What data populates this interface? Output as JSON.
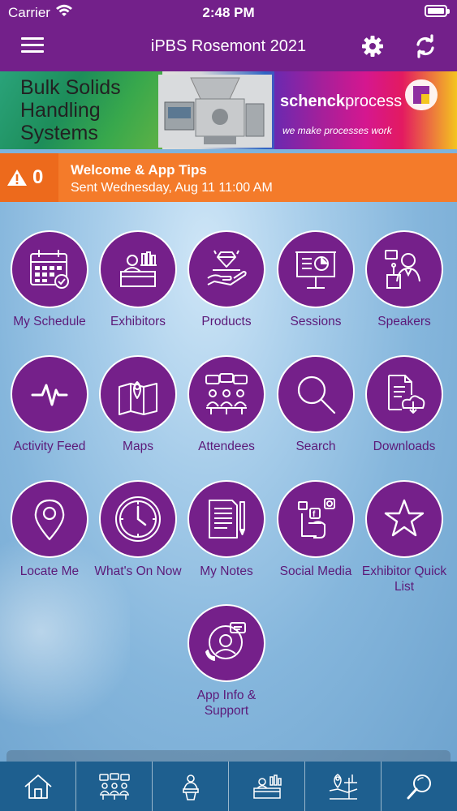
{
  "status_bar": {
    "carrier": "Carrier",
    "time": "2:48 PM"
  },
  "header": {
    "title": "iPBS Rosemont 2021"
  },
  "banner": {
    "headline": [
      "Bulk Solids",
      "Handling",
      "Systems"
    ],
    "brand_prefix": "schenck",
    "brand_suffix": "process",
    "slogan": "we make processes work"
  },
  "alert": {
    "count": "0",
    "title": "Welcome & App Tips",
    "subtitle": "Sent Wednesday, Aug 11 11:00 AM"
  },
  "tiles": [
    {
      "label": "My Schedule",
      "icon": "calendar-icon"
    },
    {
      "label": "Exhibitors",
      "icon": "exhibitor-booth-icon"
    },
    {
      "label": "Products",
      "icon": "product-hand-icon"
    },
    {
      "label": "Sessions",
      "icon": "presentation-board-icon"
    },
    {
      "label": "Speakers",
      "icon": "speaker-podium-icon"
    },
    {
      "label": "Activity Feed",
      "icon": "pulse-icon"
    },
    {
      "label": "Maps",
      "icon": "map-pin-icon"
    },
    {
      "label": "Attendees",
      "icon": "attendees-icon"
    },
    {
      "label": "Search",
      "icon": "search-icon"
    },
    {
      "label": "Downloads",
      "icon": "download-cloud-icon"
    },
    {
      "label": "Locate Me",
      "icon": "location-pin-icon"
    },
    {
      "label": "What's On Now",
      "icon": "clock-icon"
    },
    {
      "label": "My Notes",
      "icon": "notes-icon"
    },
    {
      "label": "Social Media",
      "icon": "social-media-icon"
    },
    {
      "label": "Exhibitor Quick List",
      "icon": "star-icon"
    },
    {
      "label": "App Info & Support",
      "icon": "support-icon"
    }
  ],
  "tab_bar": [
    "home-icon",
    "attendees-icon",
    "speaker-icon",
    "exhibitor-booth-icon",
    "map-icon",
    "search-icon"
  ],
  "colors": {
    "header": "#73208a",
    "tile": "#75208a",
    "alert": "#f47b2a",
    "tab_bar": "#1e5f8f"
  }
}
